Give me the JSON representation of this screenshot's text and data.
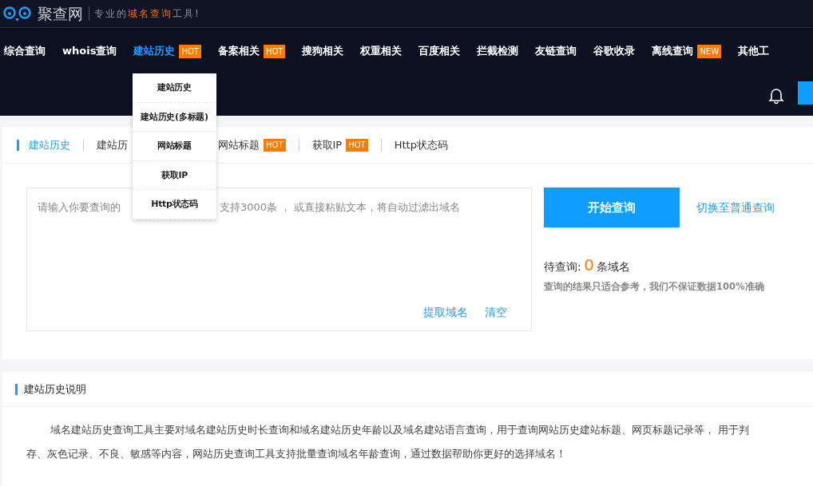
{
  "logo": {
    "name": "聚查网",
    "slogan": [
      {
        "text": "专业的",
        "highlight": false
      },
      {
        "text": "域名查询",
        "highlight": true
      },
      {
        "text": "工具!",
        "highlight": false
      }
    ]
  },
  "nav": [
    {
      "label": "综合查询",
      "selected": false
    },
    {
      "label": "whois查询",
      "selected": false
    },
    {
      "label": "建站历史",
      "selected": true,
      "badge": "HOT"
    },
    {
      "label": "备案相关",
      "selected": false,
      "badge": "HOT"
    },
    {
      "label": "搜狗相关",
      "selected": false
    },
    {
      "label": "权重相关",
      "selected": false
    },
    {
      "label": "百度相关",
      "selected": false
    },
    {
      "label": "拦截检测",
      "selected": false
    },
    {
      "label": "友链查询",
      "selected": false
    },
    {
      "label": "谷歌收录",
      "selected": false
    },
    {
      "label": "离线查询",
      "selected": false,
      "badge": "NEW"
    },
    {
      "label": "其他工",
      "selected": false
    }
  ],
  "dropdown": [
    "建站历史",
    "建站历史(多标题)",
    "网站标题",
    "获取IP",
    "Http状态码"
  ],
  "tabs": [
    {
      "label": "建站历史",
      "selected": true
    },
    {
      "label": "建站历",
      "selected": false
    },
    {
      "label": "网站标题",
      "selected": false,
      "badge": "HOT"
    },
    {
      "label": "获取IP",
      "selected": false,
      "badge": "HOT"
    },
    {
      "label": "Http状态码",
      "selected": false
    }
  ],
  "query": {
    "placeholder_parts": [
      "请输入你要查询的",
      "支持3000条 ， 或直接粘贴文本，将自动过滤出域名"
    ],
    "links": [
      "提取域名",
      "清空"
    ],
    "button": "开始查询",
    "switch_link": "切换至普通查询",
    "pending_label": "待查询:",
    "pending_count": "0",
    "pending_unit": "条域名",
    "note": "查询的结果只适合参考，我们不保证数据100%准确"
  },
  "description": {
    "title": "建站历史说明",
    "lines": [
      "域名建站历史查询工具主要对域名建站历史时长查询和域名建站历史年龄以及域名建站语言查询，用于查询网站历史建站标题、网页标题记录等， 用于判",
      "存、灰色记录、不良、敏感等内容，网站历史查询工具支持批量查询域名年龄查询，通过数据帮助你更好的选择域名！"
    ]
  }
}
